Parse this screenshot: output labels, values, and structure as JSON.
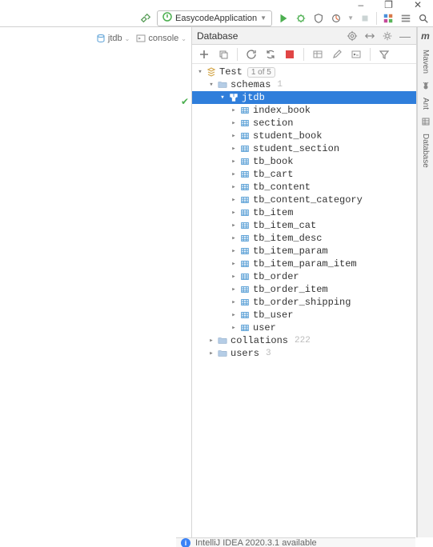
{
  "window_controls": {
    "minimize": "–",
    "maximize": "❐",
    "close": "✕"
  },
  "run_config": {
    "label": "EasycodeApplication"
  },
  "left_tabs": {
    "jtdb": "jtdb",
    "console": "console"
  },
  "db_panel": {
    "title": "Database"
  },
  "tree": {
    "root": {
      "label": "Test",
      "badge": "1 of 5"
    },
    "schemas": {
      "label": "schemas",
      "count": "1"
    },
    "jtdb": {
      "label": "jtdb"
    },
    "tables": [
      "index_book",
      "section",
      "student_book",
      "student_section",
      "tb_book",
      "tb_cart",
      "tb_content",
      "tb_content_category",
      "tb_item",
      "tb_item_cat",
      "tb_item_desc",
      "tb_item_param",
      "tb_item_param_item",
      "tb_order",
      "tb_order_item",
      "tb_order_shipping",
      "tb_user",
      "user"
    ],
    "collations": {
      "label": "collations",
      "count": "222"
    },
    "users": {
      "label": "users",
      "count": "3"
    }
  },
  "right_tabs": {
    "maven": "Maven",
    "ant": "Ant",
    "database": "Database"
  },
  "bottom": {
    "message": "IntelliJ IDEA 2020.3.1 available"
  }
}
